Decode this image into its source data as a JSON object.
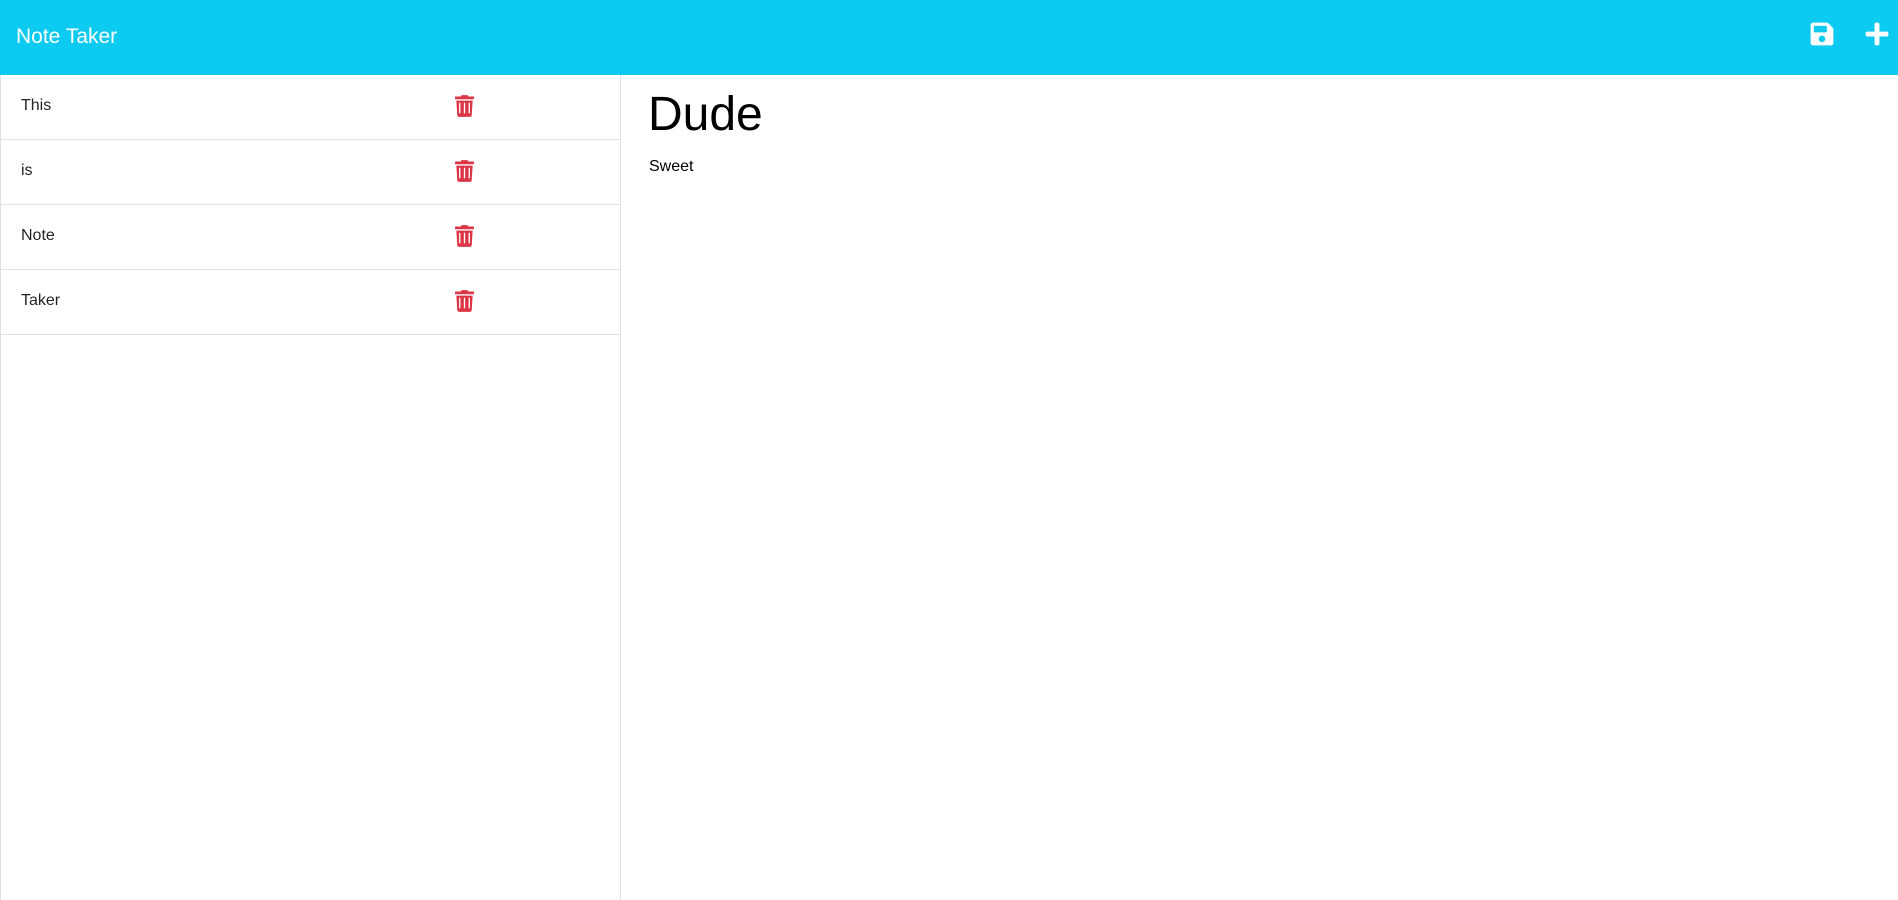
{
  "navbar": {
    "brand": "Note Taker",
    "background_color": "#0dcaf0",
    "actions": [
      {
        "name": "save",
        "icon": "save-icon"
      },
      {
        "name": "new-note",
        "icon": "plus-icon"
      }
    ]
  },
  "notes": [
    {
      "title": "This",
      "delete_icon": "trash-icon"
    },
    {
      "title": "is",
      "delete_icon": "trash-icon"
    },
    {
      "title": "Note",
      "delete_icon": "trash-icon"
    },
    {
      "title": "Taker",
      "delete_icon": "trash-icon"
    }
  ],
  "active_note": {
    "title": "Dude",
    "text": "Sweet"
  },
  "colors": {
    "accent": "#0dcaf0",
    "delete": "#dc3545",
    "border": "#dee2e6"
  }
}
